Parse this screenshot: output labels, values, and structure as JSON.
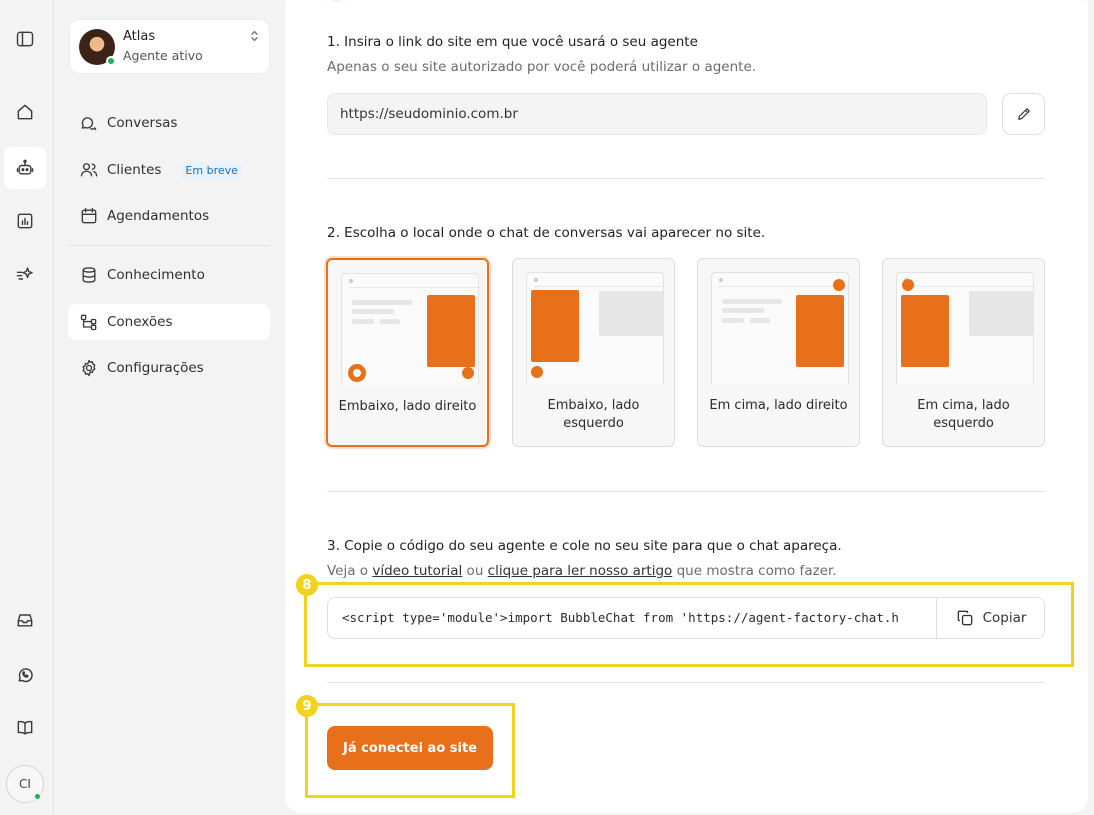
{
  "rail": {
    "items": [
      "sidebar-toggle",
      "home",
      "agent",
      "reports",
      "automations",
      "inbox",
      "whatsapp",
      "docs"
    ],
    "user_initials": "CI"
  },
  "agent": {
    "name": "Atlas",
    "status": "Agente ativo",
    "switch": "⌃⌄"
  },
  "nav": {
    "conversations": "Conversas",
    "clients": "Clientes",
    "clients_badge": "Em breve",
    "schedules": "Agendamentos",
    "knowledge": "Conhecimento",
    "connections": "Conexões",
    "settings": "Configurações"
  },
  "step1": {
    "title": "1. Insira o link do site em que você usará o seu agente",
    "subtitle": "Apenas o seu site autorizado por você poderá utilizar o agente.",
    "url_value": "https://seudominio.com.br"
  },
  "step2": {
    "title": "2. Escolha o local onde o chat de conversas vai aparecer no site.",
    "options": [
      {
        "label": "Embaixo, lado direito",
        "selected": true
      },
      {
        "label": "Embaixo, lado esquerdo",
        "selected": false
      },
      {
        "label": "Em cima, lado direito",
        "selected": false
      },
      {
        "label": "Em cima, lado esquerdo",
        "selected": false
      }
    ]
  },
  "step3": {
    "title": "3. Copie o código do seu agente e cole no seu site para que o chat apareça.",
    "sub_prefix": "Veja o ",
    "sub_link1": "vídeo tutorial",
    "sub_mid": " ou ",
    "sub_link2": "clique para ler nosso artigo",
    "sub_suffix": " que mostra como fazer.",
    "code": "<script type='module'>import BubbleChat from 'https://agent-factory-chat.h",
    "copy_label": "Copiar"
  },
  "cta_label": "Já conectei ao site",
  "annotations": {
    "code_box": "8",
    "cta": "9"
  },
  "colors": {
    "accent": "#e8701a",
    "annotation": "#f2d21c",
    "online": "#20b15a"
  }
}
